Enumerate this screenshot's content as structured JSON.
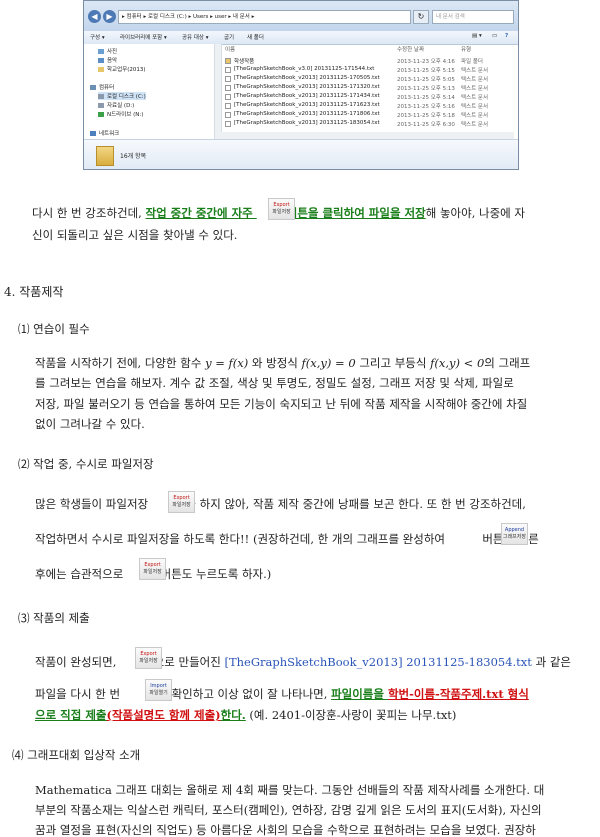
{
  "explorer": {
    "address": "▸ 컴퓨터 ▸ 로컬 디스크 (C:) ▸ Users ▸ user ▸ 내 문서 ▸",
    "search_placeholder": "내 문서 검색",
    "toolbar": [
      "구성 ▾",
      "라이브러리에 포함 ▾",
      "공유 대상 ▾",
      "굽기",
      "새 폴더"
    ],
    "nav_items": [
      "사진",
      "음악",
      "학교업무(2013)",
      "컴퓨터",
      "로컬 디스크 (C:)",
      "자료실 (D:)",
      "N드라이브 (N:)",
      "네트워크"
    ],
    "columns": [
      "이름",
      "수정한 날짜",
      "유형"
    ],
    "files": [
      {
        "name": "학생작품",
        "date": "2013-11-23 오후 4:16",
        "type": "파일 폴더"
      },
      {
        "name": "[TheGraphSketchBook_v3.0] 20131125-171544.txt",
        "date": "2013-11-25 오후 5:15",
        "type": "텍스트 문서"
      },
      {
        "name": "[TheGraphSketchBook_v2013] 20131125-170505.txt",
        "date": "2013-11-25 오후 5:05",
        "type": "텍스트 문서"
      },
      {
        "name": "[TheGraphSketchBook_v2013] 20131125-171320.txt",
        "date": "2013-11-25 오후 5:13",
        "type": "텍스트 문서"
      },
      {
        "name": "[TheGraphSketchBook_v2013] 20131125-171434.txt",
        "date": "2013-11-25 오후 5:14",
        "type": "텍스트 문서"
      },
      {
        "name": "[TheGraphSketchBook_v2013] 20131125-171623.txt",
        "date": "2013-11-25 오후 5:16",
        "type": "텍스트 문서"
      },
      {
        "name": "[TheGraphSketchBook_v2013] 20131125-171806.txt",
        "date": "2013-11-25 오후 5:18",
        "type": "텍스트 문서"
      },
      {
        "name": "[TheGraphSketchBook_v2013] 20131125-183054.txt",
        "date": "2013-11-25 오후 6:30",
        "type": "텍스트 문서"
      }
    ],
    "item_count": "16개 항목"
  },
  "buttons": {
    "export_top": "Export",
    "export_bot": "파일저장",
    "append_top": "Append",
    "append_bot": "그래프저장",
    "import_top": "Import",
    "import_bot": "파일열기"
  },
  "doc": {
    "p1a": "다시 한 번 강조하건데, ",
    "p1b": "작업 중간 중간에 자주 ",
    "p1c": "버튼을 클릭하여 파일을 저장",
    "p1d": "해 놓아야, 나중에 자",
    "p1e": "신이 되돌리고 싶은 시점을 찾아낼 수 있다.",
    "h4": "4. 작품제작",
    "s1": "⑴ 연습이 필수",
    "s1p1a": "작품을 시작하기 전에, 다양한 함수 ",
    "s1p1b": "y = f(x)",
    "s1p1c": " 와 방정식 ",
    "s1p1d": "f(x,y) = 0",
    "s1p1e": " 그리고 부등식 ",
    "s1p1f": "f(x,y) < 0",
    "s1p1g": "의 그래프",
    "s1p2": "를 그려보는 연습을 해보자. 계수 값 조절, 색상 및 투명도, 정밀도 설정, 그래프 저장 및 삭제, 파일로",
    "s1p3": "저장, 파일 불러오기 등 연습을 통하여 모든 기능이 숙지되고 난 뒤에 작품 제작을 시작해야 중간에 차질",
    "s1p4": "없이 그려나갈 수 있다.",
    "s2": "⑵ 작업 중, 수시로 파일저장",
    "s2p1a": "많은 학생들이 파일저장 ",
    "s2p1b": " 을 하지 않아, 작품 제작 중간에 낭패를 보곤 한다. 또 한 번 강조하건데,",
    "s2p2a": "작업하면서 수시로 파일저장을 하도록 한다!! (권장하건데, 한 개의 그래프를 완성하여 ",
    "s2p2b": " 버튼을 누른",
    "s2p3a": "후에는 습관적으로 ",
    "s2p3b": " 버튼도 누르도록 하자.)",
    "s3": "⑶ 작품의 제출",
    "s3p1a": "작품이 완성되면, ",
    "s3p1b": " 으로 만들어진 ",
    "s3p1c": "[TheGraphSketchBook_v2013] 20131125-183054.txt",
    "s3p1d": " 과 같은",
    "s3p2a": "파일을 다시 한 번 ",
    "s3p2b": " 로 확인하고 이상 없이 잘 나타나면, ",
    "s3p2c": "파일이름을 ",
    "s3p2d": "학번-이름-작품주제.txt 형식",
    "s3p3a": "으로 직접 제출",
    "s3p3b": "(작품설명도 함께 제출)",
    "s3p3c": "한다.",
    "s3p3d": " (예. 2401-이장훈-사랑이 꽃피는 나무.txt)",
    "s4": "⑷ 그래프대회 입상작 소개",
    "s4p1": "Mathematica 그래프 대회는 올해로 제 4회 째를 맞는다. 그동안 선배들의 작품 제작사례를 소개한다. 대",
    "s4p2": "부분의 작품소재는 익살스런 캐릭터, 포스터(캠페인), 연하장, 감명 깊게 읽은 도서의 표지(도서화), 자신의",
    "s4p3": "꿈과 열정을 표현(자신의 직업도) 등 아름다운 사회의 모습을 수학으로 표현하려는 모습을 보였다. 권장하"
  }
}
